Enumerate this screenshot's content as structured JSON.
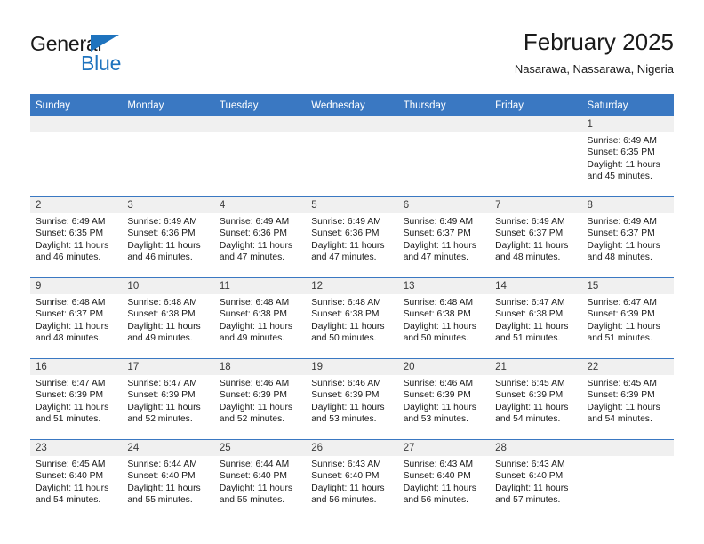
{
  "brand": {
    "name_top": "General",
    "name_bottom": "Blue",
    "triangle_icon": "triangle-icon",
    "accent_color": "#1e73be"
  },
  "header": {
    "title": "February 2025",
    "subtitle": "Nasarawa, Nassarawa, Nigeria"
  },
  "theme": {
    "header_row_bg": "#3a78c2",
    "day_band_bg": "#f0f0f0",
    "grid_line": "#3a78c2"
  },
  "weekday_headers": [
    "Sunday",
    "Monday",
    "Tuesday",
    "Wednesday",
    "Thursday",
    "Friday",
    "Saturday"
  ],
  "weeks": [
    [
      {
        "day": "",
        "sunrise": "",
        "sunset": "",
        "daylight": "",
        "empty": true
      },
      {
        "day": "",
        "sunrise": "",
        "sunset": "",
        "daylight": "",
        "empty": true
      },
      {
        "day": "",
        "sunrise": "",
        "sunset": "",
        "daylight": "",
        "empty": true
      },
      {
        "day": "",
        "sunrise": "",
        "sunset": "",
        "daylight": "",
        "empty": true
      },
      {
        "day": "",
        "sunrise": "",
        "sunset": "",
        "daylight": "",
        "empty": true
      },
      {
        "day": "",
        "sunrise": "",
        "sunset": "",
        "daylight": "",
        "empty": true
      },
      {
        "day": "1",
        "sunrise": "Sunrise: 6:49 AM",
        "sunset": "Sunset: 6:35 PM",
        "daylight": "Daylight: 11 hours and 45 minutes.",
        "empty": false
      }
    ],
    [
      {
        "day": "2",
        "sunrise": "Sunrise: 6:49 AM",
        "sunset": "Sunset: 6:35 PM",
        "daylight": "Daylight: 11 hours and 46 minutes.",
        "empty": false
      },
      {
        "day": "3",
        "sunrise": "Sunrise: 6:49 AM",
        "sunset": "Sunset: 6:36 PM",
        "daylight": "Daylight: 11 hours and 46 minutes.",
        "empty": false
      },
      {
        "day": "4",
        "sunrise": "Sunrise: 6:49 AM",
        "sunset": "Sunset: 6:36 PM",
        "daylight": "Daylight: 11 hours and 47 minutes.",
        "empty": false
      },
      {
        "day": "5",
        "sunrise": "Sunrise: 6:49 AM",
        "sunset": "Sunset: 6:36 PM",
        "daylight": "Daylight: 11 hours and 47 minutes.",
        "empty": false
      },
      {
        "day": "6",
        "sunrise": "Sunrise: 6:49 AM",
        "sunset": "Sunset: 6:37 PM",
        "daylight": "Daylight: 11 hours and 47 minutes.",
        "empty": false
      },
      {
        "day": "7",
        "sunrise": "Sunrise: 6:49 AM",
        "sunset": "Sunset: 6:37 PM",
        "daylight": "Daylight: 11 hours and 48 minutes.",
        "empty": false
      },
      {
        "day": "8",
        "sunrise": "Sunrise: 6:49 AM",
        "sunset": "Sunset: 6:37 PM",
        "daylight": "Daylight: 11 hours and 48 minutes.",
        "empty": false
      }
    ],
    [
      {
        "day": "9",
        "sunrise": "Sunrise: 6:48 AM",
        "sunset": "Sunset: 6:37 PM",
        "daylight": "Daylight: 11 hours and 48 minutes.",
        "empty": false
      },
      {
        "day": "10",
        "sunrise": "Sunrise: 6:48 AM",
        "sunset": "Sunset: 6:38 PM",
        "daylight": "Daylight: 11 hours and 49 minutes.",
        "empty": false
      },
      {
        "day": "11",
        "sunrise": "Sunrise: 6:48 AM",
        "sunset": "Sunset: 6:38 PM",
        "daylight": "Daylight: 11 hours and 49 minutes.",
        "empty": false
      },
      {
        "day": "12",
        "sunrise": "Sunrise: 6:48 AM",
        "sunset": "Sunset: 6:38 PM",
        "daylight": "Daylight: 11 hours and 50 minutes.",
        "empty": false
      },
      {
        "day": "13",
        "sunrise": "Sunrise: 6:48 AM",
        "sunset": "Sunset: 6:38 PM",
        "daylight": "Daylight: 11 hours and 50 minutes.",
        "empty": false
      },
      {
        "day": "14",
        "sunrise": "Sunrise: 6:47 AM",
        "sunset": "Sunset: 6:38 PM",
        "daylight": "Daylight: 11 hours and 51 minutes.",
        "empty": false
      },
      {
        "day": "15",
        "sunrise": "Sunrise: 6:47 AM",
        "sunset": "Sunset: 6:39 PM",
        "daylight": "Daylight: 11 hours and 51 minutes.",
        "empty": false
      }
    ],
    [
      {
        "day": "16",
        "sunrise": "Sunrise: 6:47 AM",
        "sunset": "Sunset: 6:39 PM",
        "daylight": "Daylight: 11 hours and 51 minutes.",
        "empty": false
      },
      {
        "day": "17",
        "sunrise": "Sunrise: 6:47 AM",
        "sunset": "Sunset: 6:39 PM",
        "daylight": "Daylight: 11 hours and 52 minutes.",
        "empty": false
      },
      {
        "day": "18",
        "sunrise": "Sunrise: 6:46 AM",
        "sunset": "Sunset: 6:39 PM",
        "daylight": "Daylight: 11 hours and 52 minutes.",
        "empty": false
      },
      {
        "day": "19",
        "sunrise": "Sunrise: 6:46 AM",
        "sunset": "Sunset: 6:39 PM",
        "daylight": "Daylight: 11 hours and 53 minutes.",
        "empty": false
      },
      {
        "day": "20",
        "sunrise": "Sunrise: 6:46 AM",
        "sunset": "Sunset: 6:39 PM",
        "daylight": "Daylight: 11 hours and 53 minutes.",
        "empty": false
      },
      {
        "day": "21",
        "sunrise": "Sunrise: 6:45 AM",
        "sunset": "Sunset: 6:39 PM",
        "daylight": "Daylight: 11 hours and 54 minutes.",
        "empty": false
      },
      {
        "day": "22",
        "sunrise": "Sunrise: 6:45 AM",
        "sunset": "Sunset: 6:39 PM",
        "daylight": "Daylight: 11 hours and 54 minutes.",
        "empty": false
      }
    ],
    [
      {
        "day": "23",
        "sunrise": "Sunrise: 6:45 AM",
        "sunset": "Sunset: 6:40 PM",
        "daylight": "Daylight: 11 hours and 54 minutes.",
        "empty": false
      },
      {
        "day": "24",
        "sunrise": "Sunrise: 6:44 AM",
        "sunset": "Sunset: 6:40 PM",
        "daylight": "Daylight: 11 hours and 55 minutes.",
        "empty": false
      },
      {
        "day": "25",
        "sunrise": "Sunrise: 6:44 AM",
        "sunset": "Sunset: 6:40 PM",
        "daylight": "Daylight: 11 hours and 55 minutes.",
        "empty": false
      },
      {
        "day": "26",
        "sunrise": "Sunrise: 6:43 AM",
        "sunset": "Sunset: 6:40 PM",
        "daylight": "Daylight: 11 hours and 56 minutes.",
        "empty": false
      },
      {
        "day": "27",
        "sunrise": "Sunrise: 6:43 AM",
        "sunset": "Sunset: 6:40 PM",
        "daylight": "Daylight: 11 hours and 56 minutes.",
        "empty": false
      },
      {
        "day": "28",
        "sunrise": "Sunrise: 6:43 AM",
        "sunset": "Sunset: 6:40 PM",
        "daylight": "Daylight: 11 hours and 57 minutes.",
        "empty": false
      },
      {
        "day": "",
        "sunrise": "",
        "sunset": "",
        "daylight": "",
        "empty": true
      }
    ]
  ]
}
